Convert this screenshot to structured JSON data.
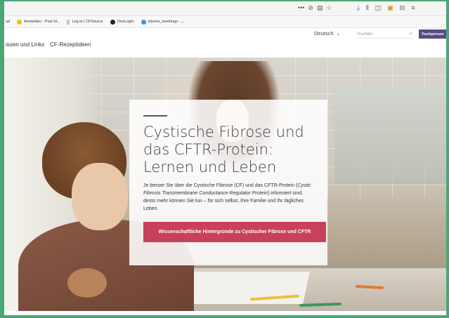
{
  "browser": {
    "toolbar_icons": [
      "more-icon",
      "pocket-icon",
      "reader-icon",
      "star-icon"
    ],
    "right_icons": [
      "download-icon",
      "library-icon",
      "sidebar-icon",
      "extension-icon",
      "screenshot-icon",
      "menu-icon"
    ]
  },
  "bookmarks": [
    {
      "label": "ud",
      "icon_color": ""
    },
    {
      "label": "Anmelden - Post Id...",
      "icon_color": "#f2c200"
    },
    {
      "label": "Log in | CFSource",
      "icon_color": "#8aa"
    },
    {
      "label": "OneLogin",
      "icon_color": "#222"
    },
    {
      "label": "interne_meetings - ...",
      "icon_color": "#4a90d9"
    }
  ],
  "nav": {
    "menu": [
      "issen und Links",
      "CF-Rezeptideen"
    ],
    "language": "Deutsch",
    "search_placeholder": "Suchen",
    "fachpersonal_label": "Fachperson"
  },
  "hero": {
    "title_lines": [
      "Cystische Fibrose und",
      "das CFTR-Protein:",
      "Lernen und Leben"
    ],
    "desc_part1": "Je besser Sie über die Cystische Fibrose (CF) und das CFTR-Protein (",
    "desc_italic": "Cystic Fibrosis Transmembrane Conductance Regulator Protein",
    "desc_part2": ") informiert sind, desto mehr können Sie tun – für sich selbst, Ihre Familie und Ihr tägliches Leben.",
    "cta_label": "Wissenschaftliche Hintergründe zu Cystischer Fibrose und CFTR"
  },
  "colors": {
    "frame": "#4aa877",
    "accent": "#5a4a82",
    "cta": "#c8405a"
  }
}
